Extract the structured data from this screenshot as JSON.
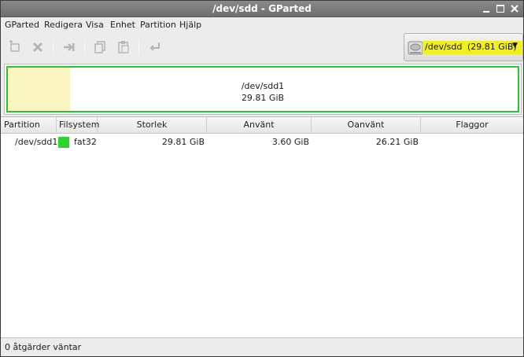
{
  "window": {
    "title": "/dev/sdd - GParted"
  },
  "menu": [
    "GParted",
    "Redigera",
    "Visa",
    "Enhet",
    "Partition",
    "Hjälp"
  ],
  "toolbar": {
    "buttons": [
      "new-partition-icon",
      "delete-icon",
      "resize-move-icon",
      "copy-icon",
      "paste-icon",
      "undo-icon"
    ],
    "device_selector": {
      "device": "/dev/sdd",
      "size": "(29.81 GiB)",
      "highlight_color": "#f2ef1a"
    }
  },
  "partition_map": {
    "name": "/dev/sdd1",
    "size": "29.81 GiB",
    "used_fraction": 0.121,
    "border_color": "#2ac434",
    "used_color": "#f9f6c0"
  },
  "table": {
    "columns": [
      "Partition",
      "Filsystem",
      "Storlek",
      "Använt",
      "Oanvänt",
      "Flaggor"
    ],
    "rows": [
      {
        "partition": "/dev/sdd1",
        "filesystem": "fat32",
        "fs_color": "#2cd42c",
        "size": "29.81 GiB",
        "used": "3.60 GiB",
        "unused": "26.21 GiB",
        "flags": ""
      }
    ]
  },
  "status": {
    "text": "0 åtgärder väntar"
  }
}
